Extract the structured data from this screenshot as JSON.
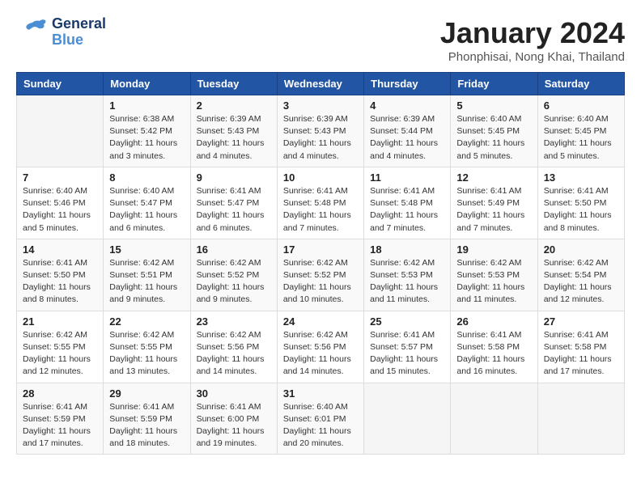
{
  "header": {
    "logo_general": "General",
    "logo_blue": "Blue",
    "month_title": "January 2024",
    "location": "Phonphisai, Nong Khai, Thailand"
  },
  "days_of_week": [
    "Sunday",
    "Monday",
    "Tuesday",
    "Wednesday",
    "Thursday",
    "Friday",
    "Saturday"
  ],
  "weeks": [
    [
      {
        "day": "",
        "content": ""
      },
      {
        "day": "1",
        "content": "Sunrise: 6:38 AM\nSunset: 5:42 PM\nDaylight: 11 hours\nand 3 minutes."
      },
      {
        "day": "2",
        "content": "Sunrise: 6:39 AM\nSunset: 5:43 PM\nDaylight: 11 hours\nand 4 minutes."
      },
      {
        "day": "3",
        "content": "Sunrise: 6:39 AM\nSunset: 5:43 PM\nDaylight: 11 hours\nand 4 minutes."
      },
      {
        "day": "4",
        "content": "Sunrise: 6:39 AM\nSunset: 5:44 PM\nDaylight: 11 hours\nand 4 minutes."
      },
      {
        "day": "5",
        "content": "Sunrise: 6:40 AM\nSunset: 5:45 PM\nDaylight: 11 hours\nand 5 minutes."
      },
      {
        "day": "6",
        "content": "Sunrise: 6:40 AM\nSunset: 5:45 PM\nDaylight: 11 hours\nand 5 minutes."
      }
    ],
    [
      {
        "day": "7",
        "content": "Sunrise: 6:40 AM\nSunset: 5:46 PM\nDaylight: 11 hours\nand 5 minutes."
      },
      {
        "day": "8",
        "content": "Sunrise: 6:40 AM\nSunset: 5:47 PM\nDaylight: 11 hours\nand 6 minutes."
      },
      {
        "day": "9",
        "content": "Sunrise: 6:41 AM\nSunset: 5:47 PM\nDaylight: 11 hours\nand 6 minutes."
      },
      {
        "day": "10",
        "content": "Sunrise: 6:41 AM\nSunset: 5:48 PM\nDaylight: 11 hours\nand 7 minutes."
      },
      {
        "day": "11",
        "content": "Sunrise: 6:41 AM\nSunset: 5:48 PM\nDaylight: 11 hours\nand 7 minutes."
      },
      {
        "day": "12",
        "content": "Sunrise: 6:41 AM\nSunset: 5:49 PM\nDaylight: 11 hours\nand 7 minutes."
      },
      {
        "day": "13",
        "content": "Sunrise: 6:41 AM\nSunset: 5:50 PM\nDaylight: 11 hours\nand 8 minutes."
      }
    ],
    [
      {
        "day": "14",
        "content": "Sunrise: 6:41 AM\nSunset: 5:50 PM\nDaylight: 11 hours\nand 8 minutes."
      },
      {
        "day": "15",
        "content": "Sunrise: 6:42 AM\nSunset: 5:51 PM\nDaylight: 11 hours\nand 9 minutes."
      },
      {
        "day": "16",
        "content": "Sunrise: 6:42 AM\nSunset: 5:52 PM\nDaylight: 11 hours\nand 9 minutes."
      },
      {
        "day": "17",
        "content": "Sunrise: 6:42 AM\nSunset: 5:52 PM\nDaylight: 11 hours\nand 10 minutes."
      },
      {
        "day": "18",
        "content": "Sunrise: 6:42 AM\nSunset: 5:53 PM\nDaylight: 11 hours\nand 11 minutes."
      },
      {
        "day": "19",
        "content": "Sunrise: 6:42 AM\nSunset: 5:53 PM\nDaylight: 11 hours\nand 11 minutes."
      },
      {
        "day": "20",
        "content": "Sunrise: 6:42 AM\nSunset: 5:54 PM\nDaylight: 11 hours\nand 12 minutes."
      }
    ],
    [
      {
        "day": "21",
        "content": "Sunrise: 6:42 AM\nSunset: 5:55 PM\nDaylight: 11 hours\nand 12 minutes."
      },
      {
        "day": "22",
        "content": "Sunrise: 6:42 AM\nSunset: 5:55 PM\nDaylight: 11 hours\nand 13 minutes."
      },
      {
        "day": "23",
        "content": "Sunrise: 6:42 AM\nSunset: 5:56 PM\nDaylight: 11 hours\nand 14 minutes."
      },
      {
        "day": "24",
        "content": "Sunrise: 6:42 AM\nSunset: 5:56 PM\nDaylight: 11 hours\nand 14 minutes."
      },
      {
        "day": "25",
        "content": "Sunrise: 6:41 AM\nSunset: 5:57 PM\nDaylight: 11 hours\nand 15 minutes."
      },
      {
        "day": "26",
        "content": "Sunrise: 6:41 AM\nSunset: 5:58 PM\nDaylight: 11 hours\nand 16 minutes."
      },
      {
        "day": "27",
        "content": "Sunrise: 6:41 AM\nSunset: 5:58 PM\nDaylight: 11 hours\nand 17 minutes."
      }
    ],
    [
      {
        "day": "28",
        "content": "Sunrise: 6:41 AM\nSunset: 5:59 PM\nDaylight: 11 hours\nand 17 minutes."
      },
      {
        "day": "29",
        "content": "Sunrise: 6:41 AM\nSunset: 5:59 PM\nDaylight: 11 hours\nand 18 minutes."
      },
      {
        "day": "30",
        "content": "Sunrise: 6:41 AM\nSunset: 6:00 PM\nDaylight: 11 hours\nand 19 minutes."
      },
      {
        "day": "31",
        "content": "Sunrise: 6:40 AM\nSunset: 6:01 PM\nDaylight: 11 hours\nand 20 minutes."
      },
      {
        "day": "",
        "content": ""
      },
      {
        "day": "",
        "content": ""
      },
      {
        "day": "",
        "content": ""
      }
    ]
  ]
}
